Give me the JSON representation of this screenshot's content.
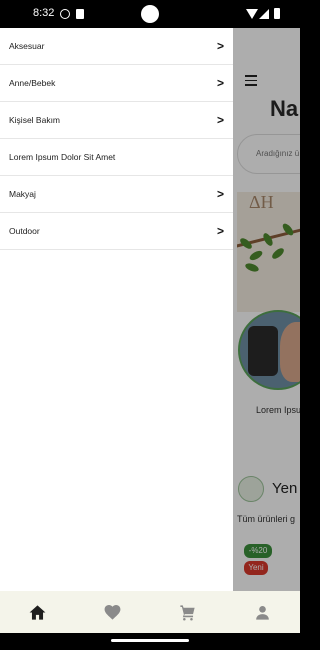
{
  "status_bar": {
    "time": "8:32"
  },
  "background": {
    "brand_title": "Na",
    "search_placeholder": "Aradığınız ü",
    "banner_text": "ΔH",
    "story_label": "Lorem Ipsu",
    "new_section_title": "Yen",
    "new_section_subtitle": "Tüm ürünleri g",
    "badge_discount": "-%20",
    "badge_new": "Yeni"
  },
  "drawer": {
    "items": [
      {
        "label": "Aksesuar",
        "has_arrow": true
      },
      {
        "label": "Anne/Bebek",
        "has_arrow": true
      },
      {
        "label": "Kişisel Bakım",
        "has_arrow": true
      },
      {
        "label": "Lorem Ipsum Dolor Sit Amet",
        "has_arrow": false
      },
      {
        "label": "Makyaj",
        "has_arrow": true
      },
      {
        "label": "Outdoor",
        "has_arrow": true
      }
    ],
    "arrow_glyph": ">"
  },
  "bottom_nav": {
    "items": [
      "home-icon",
      "heart-icon",
      "cart-icon",
      "profile-icon"
    ],
    "active_color": "#1e1e1e",
    "inactive_color": "#8a8a8a"
  }
}
